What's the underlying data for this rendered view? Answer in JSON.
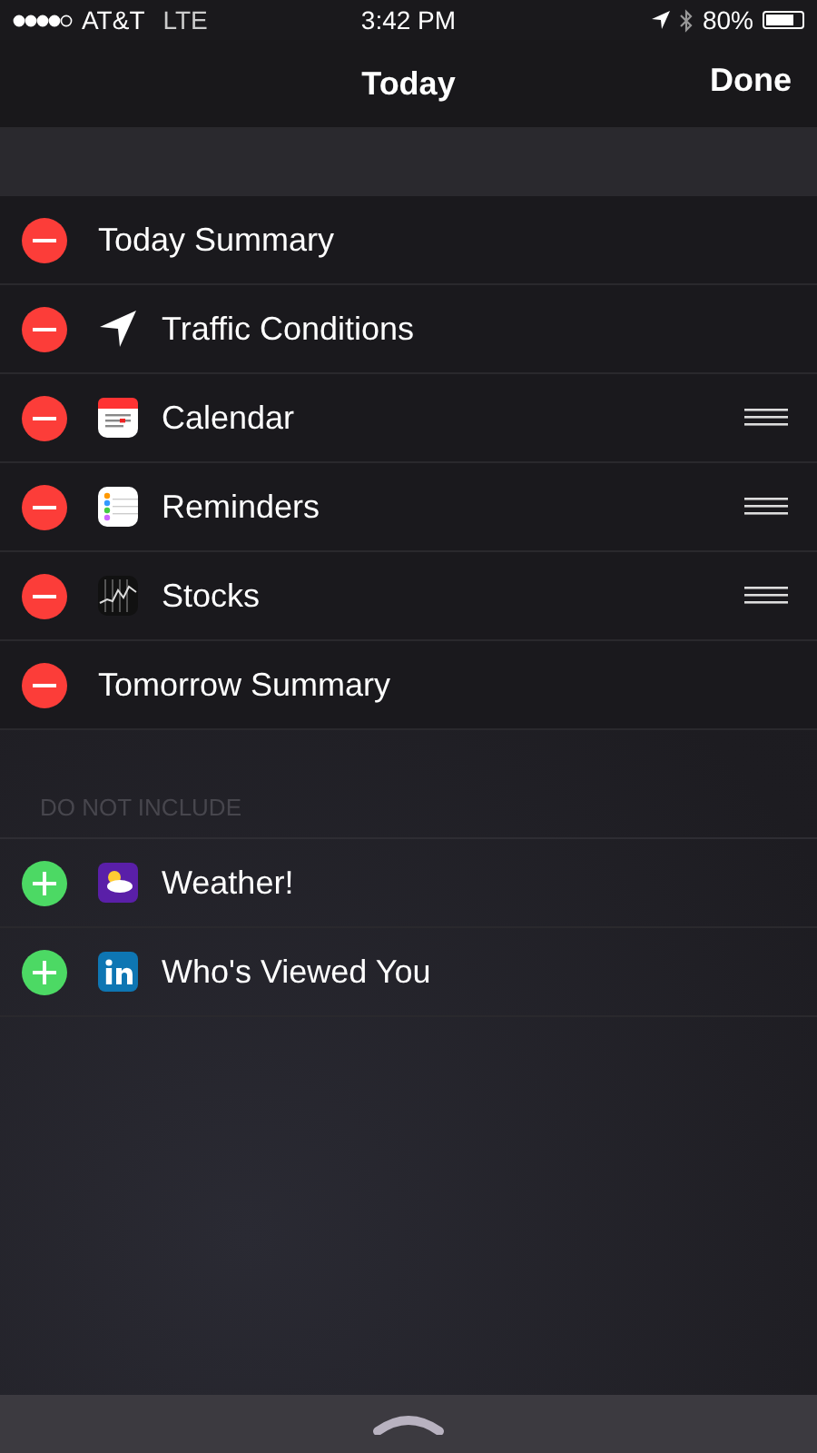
{
  "status_bar": {
    "carrier": "AT&T",
    "network": "LTE",
    "time": "3:42 PM",
    "battery": "80%"
  },
  "nav": {
    "title": "Today",
    "done": "Done"
  },
  "included": [
    {
      "label": "Today Summary",
      "kind": "plain",
      "reorderable": false
    },
    {
      "label": "Traffic Conditions",
      "kind": "location",
      "reorderable": false
    },
    {
      "label": "Calendar",
      "kind": "calendar",
      "reorderable": true
    },
    {
      "label": "Reminders",
      "kind": "reminders",
      "reorderable": true
    },
    {
      "label": "Stocks",
      "kind": "stocks",
      "reorderable": true
    },
    {
      "label": "Tomorrow Summary",
      "kind": "plain",
      "reorderable": false
    }
  ],
  "excluded_header": "DO NOT INCLUDE",
  "excluded": [
    {
      "label": "Weather!",
      "kind": "weather"
    },
    {
      "label": "Who's Viewed You",
      "kind": "linkedin"
    }
  ]
}
